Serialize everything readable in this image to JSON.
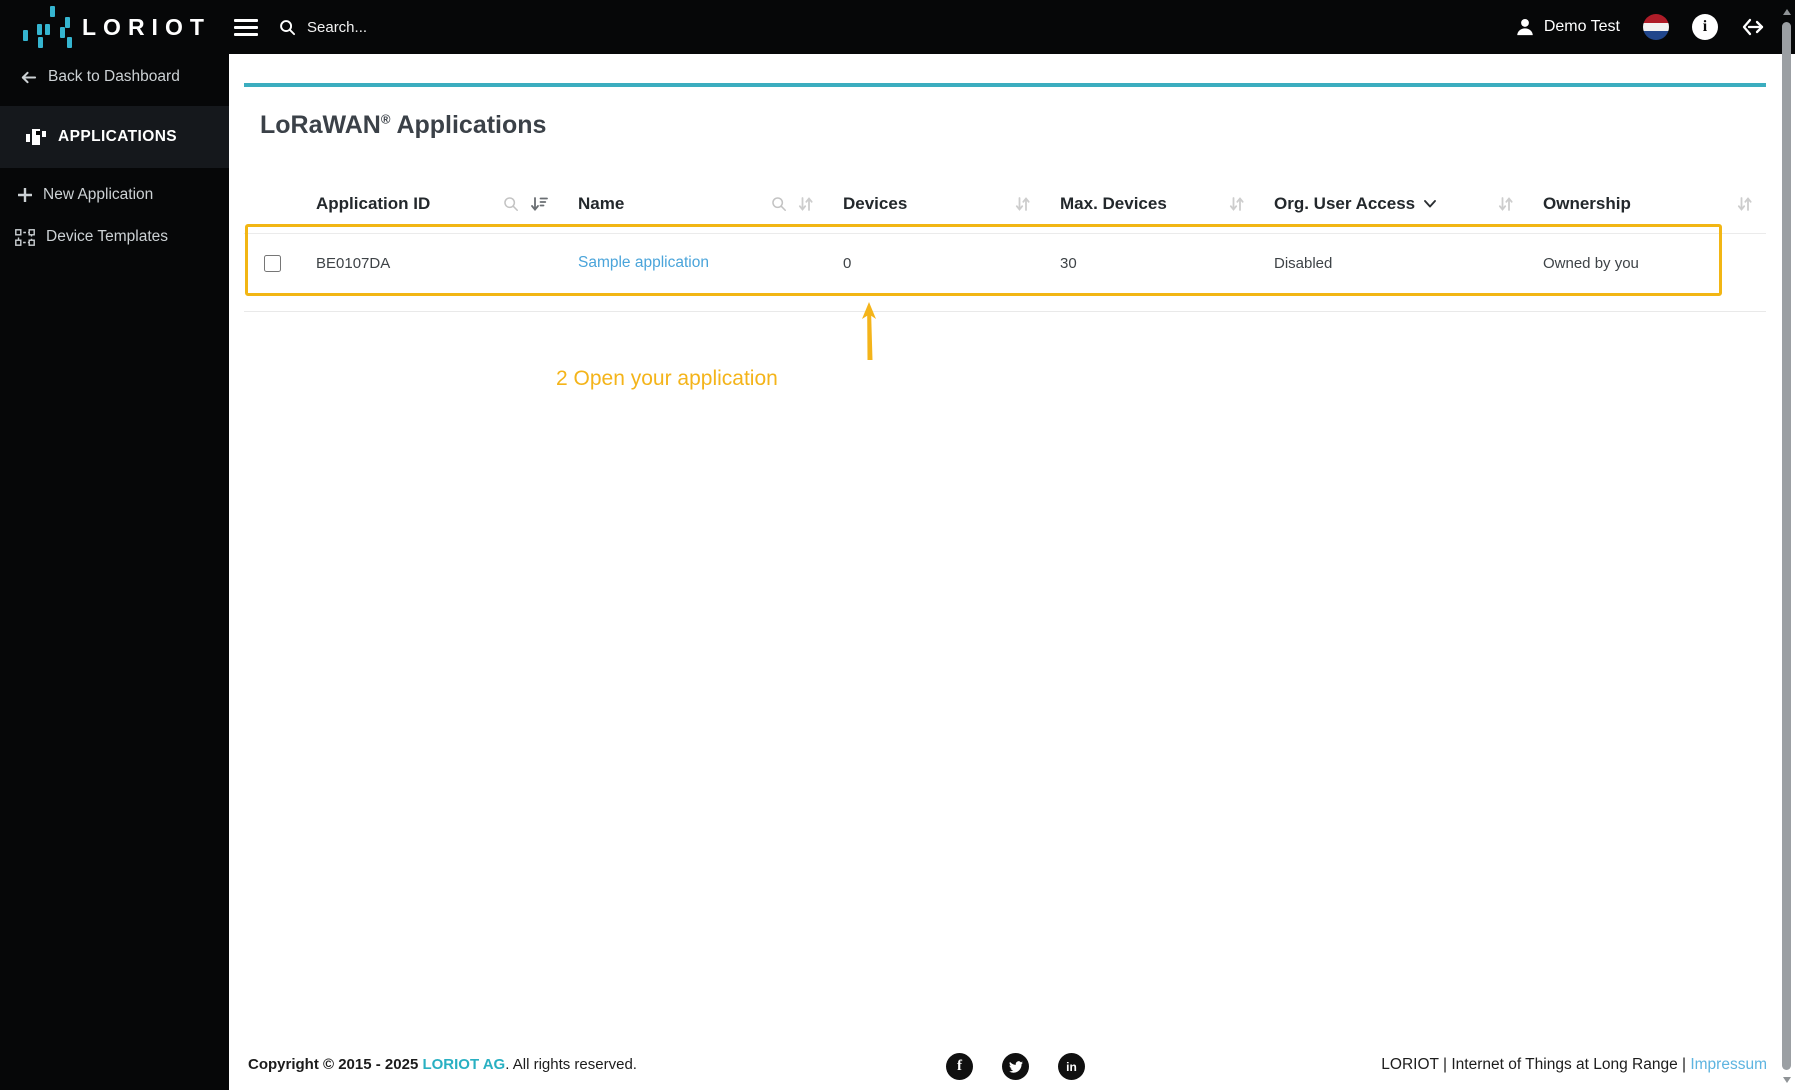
{
  "topbar": {
    "logo_text": "LORIOT",
    "search_placeholder": "Search...",
    "user_name": "Demo Test"
  },
  "sidebar": {
    "back_label": "Back to Dashboard",
    "section_label": "APPLICATIONS",
    "items": [
      {
        "label": "New Application"
      },
      {
        "label": "Device Templates"
      }
    ]
  },
  "main": {
    "title_brand": "LoRaWAN",
    "title_reg": "®",
    "title_rest": " Applications",
    "table": {
      "columns": [
        "Application ID",
        "Name",
        "Devices",
        "Max. Devices",
        "Org. User Access",
        "Ownership"
      ],
      "rows": [
        {
          "application_id": "BE0107DA",
          "name": "Sample application",
          "devices": "0",
          "max_devices": "30",
          "org_user_access": "Disabled",
          "ownership": "Owned by you"
        }
      ]
    },
    "annotation": {
      "label": "2 Open your application"
    }
  },
  "footer": {
    "copyright_prefix": "Copyright © 2015 - 2025 ",
    "brand": "LORIOT AG",
    "copyright_suffix": ". All rights reserved.",
    "tagline": "LORIOT | Internet of Things at Long Range | ",
    "impressum_label": "Impressum"
  },
  "colors": {
    "accent_teal": "#3badbf",
    "highlight_amber": "#f2b614",
    "link_blue": "#4aa4da",
    "footer_brand_cyan": "#29b0c2",
    "impressum_blue": "#5db4e0"
  }
}
